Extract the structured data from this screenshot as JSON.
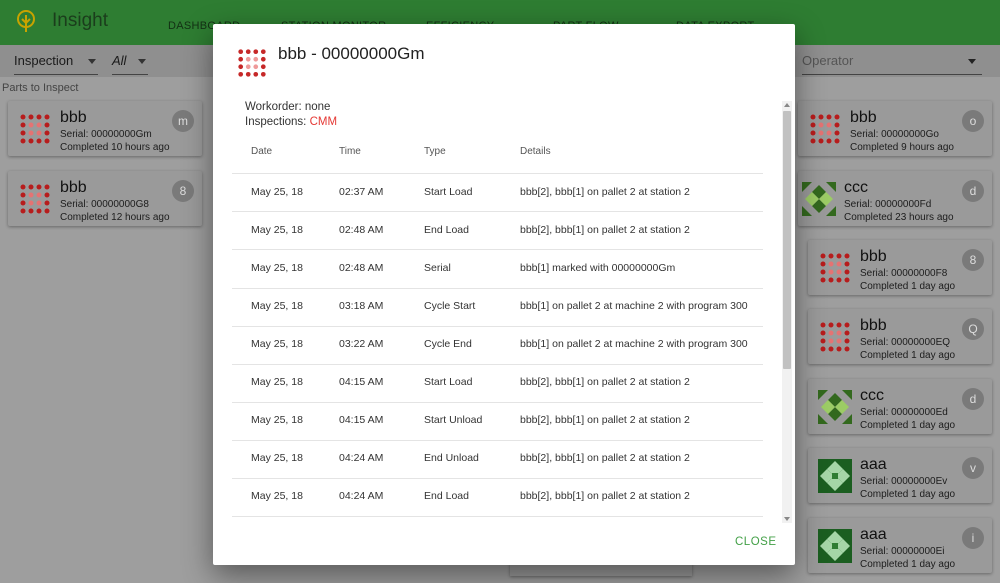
{
  "app": {
    "title": "Insight"
  },
  "nav": {
    "tabs": [
      "DASHBOARD",
      "STATION MONITOR",
      "EFFICIENCY",
      "PART FLOW",
      "DATA EXPORT"
    ]
  },
  "toolbar": {
    "view_select": "Inspection",
    "filter_select": "All",
    "operator_placeholder": "Operator"
  },
  "section": {
    "parts_label": "Parts to Inspect"
  },
  "left_cards": [
    {
      "name": "bbb",
      "serial": "Serial: 00000000Gm",
      "completed": "Completed 10 hours ago",
      "badge": "m"
    },
    {
      "name": "bbb",
      "serial": "Serial: 00000000G8",
      "completed": "Completed 12 hours ago",
      "badge": "8"
    }
  ],
  "right_cards": [
    {
      "name": "bbb",
      "serial": "Serial: 00000000Go",
      "completed": "Completed 9 hours ago",
      "badge": "o"
    },
    {
      "name": "ccc",
      "serial": "Serial: 00000000Fd",
      "completed": "Completed 23 hours ago",
      "badge": "d"
    },
    {
      "name": "bbb",
      "serial": "Serial: 00000000F8",
      "completed": "Completed 1 day ago",
      "badge": "8"
    },
    {
      "name": "bbb",
      "serial": "Serial: 00000000EQ",
      "completed": "Completed 1 day ago",
      "badge": "Q"
    },
    {
      "name": "ccc",
      "serial": "Serial: 00000000Ed",
      "completed": "Completed 1 day ago",
      "badge": "d"
    },
    {
      "name": "aaa",
      "serial": "Serial: 00000000Ev",
      "completed": "Completed 1 day ago",
      "badge": "v"
    },
    {
      "name": "aaa",
      "serial": "Serial: 00000000Ei",
      "completed": "Completed 1 day ago",
      "badge": "i"
    }
  ],
  "dialog": {
    "title": "bbb - 00000000Gm",
    "workorder_label": "Workorder: none",
    "inspections_label": "Inspections: ",
    "inspections_value": "CMM",
    "columns": [
      "Date",
      "Time",
      "Type",
      "Details"
    ],
    "rows": [
      {
        "date": "May 25, 18",
        "time": "02:37 AM",
        "type": "Start Load",
        "details": "bbb[2], bbb[1] on pallet 2 at station 2"
      },
      {
        "date": "May 25, 18",
        "time": "02:48 AM",
        "type": "End Load",
        "details": "bbb[2], bbb[1] on pallet 2 at station 2"
      },
      {
        "date": "May 25, 18",
        "time": "02:48 AM",
        "type": "Serial",
        "details": "bbb[1] marked with 00000000Gm"
      },
      {
        "date": "May 25, 18",
        "time": "03:18 AM",
        "type": "Cycle Start",
        "details": "bbb[1] on pallet 2 at machine 2 with program 300"
      },
      {
        "date": "May 25, 18",
        "time": "03:22 AM",
        "type": "Cycle End",
        "details": "bbb[1] on pallet 2 at machine 2 with program 300"
      },
      {
        "date": "May 25, 18",
        "time": "04:15 AM",
        "type": "Start Load",
        "details": "bbb[2], bbb[1] on pallet 2 at station 2"
      },
      {
        "date": "May 25, 18",
        "time": "04:15 AM",
        "type": "Start Unload",
        "details": "bbb[2], bbb[1] on pallet 2 at station 2"
      },
      {
        "date": "May 25, 18",
        "time": "04:24 AM",
        "type": "End Unload",
        "details": "bbb[2], bbb[1] on pallet 2 at station 2"
      },
      {
        "date": "May 25, 18",
        "time": "04:24 AM",
        "type": "End Load",
        "details": "bbb[2], bbb[1] on pallet 2 at station 2"
      }
    ],
    "close_label": "CLOSE"
  },
  "colors": {
    "appbar": "#2e7d32",
    "accent_green": "#43a047",
    "highlight_red": "#e53935",
    "bbb_icon": "#c62828",
    "ccc_icon": "#558b2f",
    "aaa_icon": "#2e7d32"
  }
}
